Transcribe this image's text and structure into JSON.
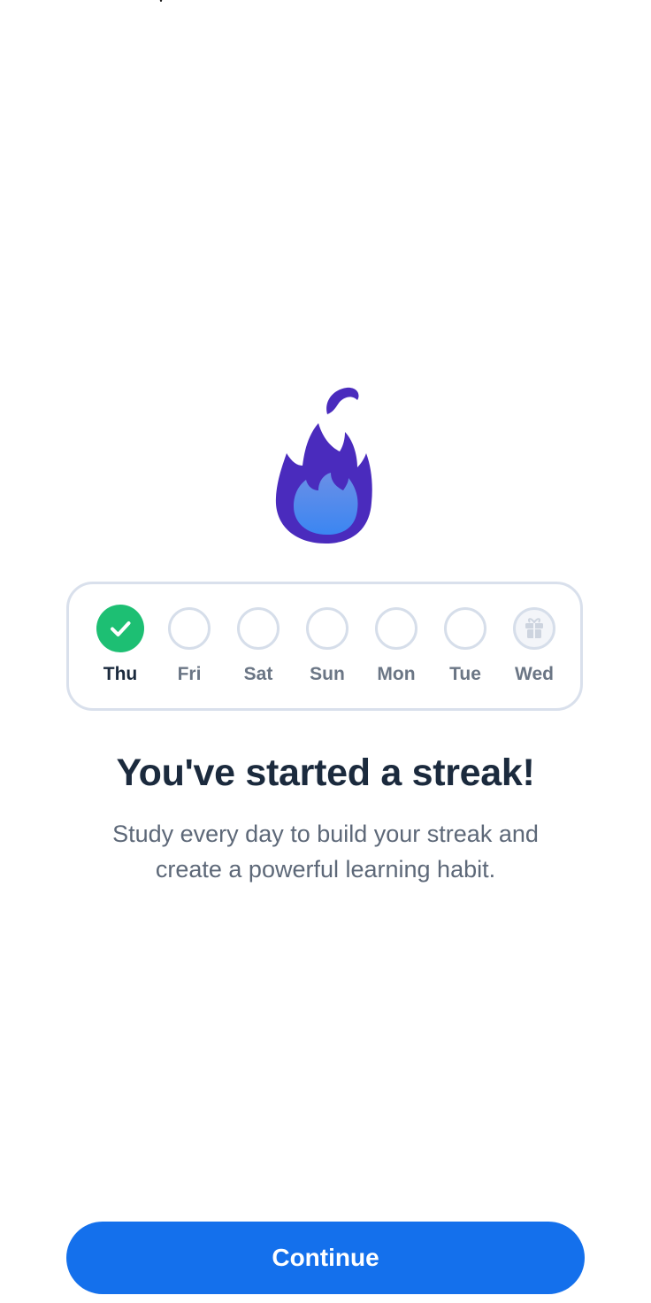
{
  "streak": {
    "days": [
      {
        "label": "Thu",
        "state": "done"
      },
      {
        "label": "Fri",
        "state": "empty"
      },
      {
        "label": "Sat",
        "state": "empty"
      },
      {
        "label": "Sun",
        "state": "empty"
      },
      {
        "label": "Mon",
        "state": "empty"
      },
      {
        "label": "Tue",
        "state": "empty"
      },
      {
        "label": "Wed",
        "state": "gift"
      }
    ]
  },
  "headline": "You've started a streak!",
  "subtitle": "Study every day to build your streak and create a powerful learning habit.",
  "continue_label": "Continue",
  "icons": {
    "flame": "flame-icon",
    "check": "check-icon",
    "gift": "gift-icon"
  },
  "colors": {
    "flame_outer": "#4a2bbd",
    "flame_inner": "#4f8cf0",
    "done": "#1dbf73",
    "button": "#1470ec",
    "headline": "#1b2a3d"
  }
}
